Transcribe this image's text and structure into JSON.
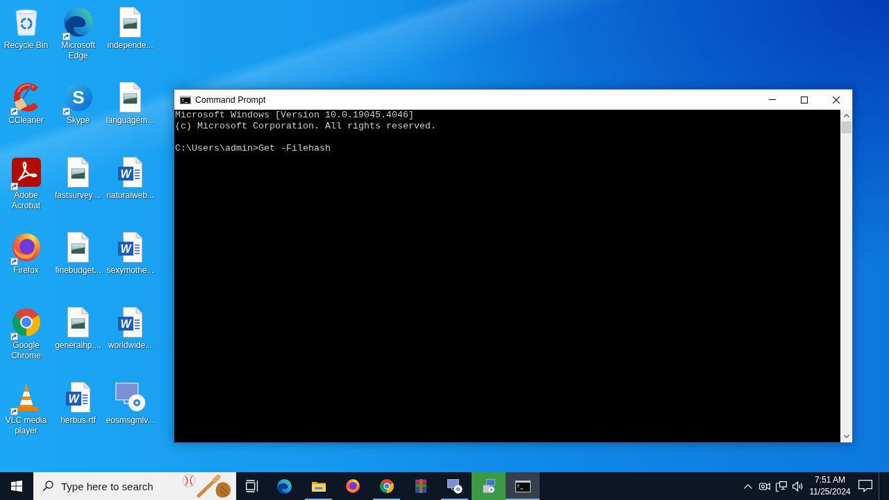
{
  "desktop": {
    "icons": [
      {
        "label": "Recycle Bin",
        "kind": "recycle-bin",
        "shortcut": false
      },
      {
        "label": "Microsoft Edge",
        "kind": "edge",
        "shortcut": true
      },
      {
        "label": "independe...",
        "kind": "image-file",
        "shortcut": false
      },
      {
        "label": "CCleaner",
        "kind": "ccleaner",
        "shortcut": true
      },
      {
        "label": "Skype",
        "kind": "skype",
        "shortcut": true,
        "glyph": "S"
      },
      {
        "label": "languagem...",
        "kind": "image-file",
        "shortcut": false
      },
      {
        "label": "Adobe Acrobat",
        "kind": "acrobat",
        "shortcut": true
      },
      {
        "label": "fastsurvey....",
        "kind": "image-file",
        "shortcut": false
      },
      {
        "label": "naturalweb...",
        "kind": "word-file",
        "shortcut": false,
        "glyph": "W"
      },
      {
        "label": "Firefox",
        "kind": "firefox",
        "shortcut": true
      },
      {
        "label": "finebudget...",
        "kind": "image-file",
        "shortcut": false
      },
      {
        "label": "sexymothe...",
        "kind": "word-file",
        "shortcut": false,
        "glyph": "W"
      },
      {
        "label": "Google Chrome",
        "kind": "chrome",
        "shortcut": true
      },
      {
        "label": "generalhp....",
        "kind": "image-file",
        "shortcut": false
      },
      {
        "label": "worldwide...",
        "kind": "word-file",
        "shortcut": false,
        "glyph": "W"
      },
      {
        "label": "VLC media player",
        "kind": "vlc",
        "shortcut": true
      },
      {
        "label": "herbus.rtf",
        "kind": "word-file",
        "shortcut": false,
        "glyph": "W"
      },
      {
        "label": "eosmsgmlv...",
        "kind": "setup-file",
        "shortcut": false
      }
    ]
  },
  "window": {
    "title": "Command Prompt",
    "console": {
      "banner": [
        "Microsoft Windows [Version 10.0.19045.4046]",
        "(c) Microsoft Corporation. All rights reserved."
      ],
      "prompt": "C:\\Users\\admin>Get -Filehash"
    }
  },
  "taskbar": {
    "search": {
      "placeholder": "Type here to search"
    },
    "apps": [
      {
        "kind": "edge",
        "running": false,
        "active": false,
        "flashing": false
      },
      {
        "kind": "folder",
        "running": true,
        "active": false,
        "flashing": false
      },
      {
        "kind": "firefox",
        "running": false,
        "active": false,
        "flashing": false
      },
      {
        "kind": "chrome",
        "running": true,
        "active": false,
        "flashing": false
      },
      {
        "kind": "archive",
        "running": false,
        "active": false,
        "flashing": false
      },
      {
        "kind": "setup-file",
        "running": true,
        "active": false,
        "flashing": false
      },
      {
        "kind": "installer",
        "running": true,
        "active": false,
        "flashing": true
      },
      {
        "kind": "console",
        "running": true,
        "active": true,
        "flashing": false
      }
    ],
    "tray": {
      "icons": [
        {
          "kind": "chevron"
        },
        {
          "kind": "camera"
        },
        {
          "kind": "network"
        },
        {
          "kind": "volume"
        }
      ],
      "time": "7:51 AM",
      "date": "11/25/2024"
    }
  }
}
